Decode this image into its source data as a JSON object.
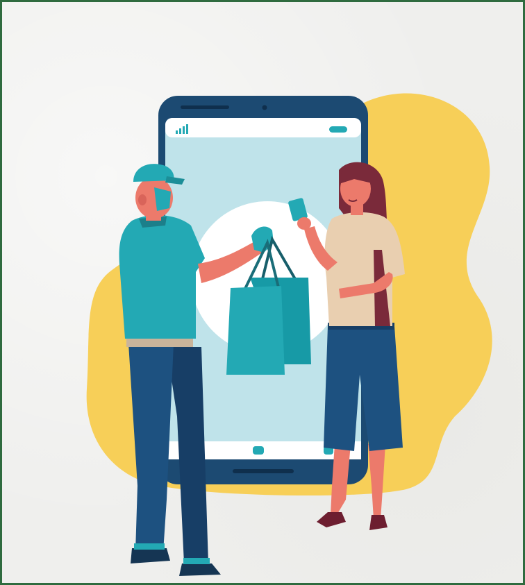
{
  "illustration": {
    "frame_color": "#2f6b3f",
    "background_color": "#efefed",
    "blob_color": "#f7cf58",
    "phone_body_color": "#1c4a72",
    "phone_screen_color": "#bfe3ea",
    "accent_color": "#23a9b4",
    "icons": [
      "signal-bars-icon",
      "battery-icon",
      "home-button-icon",
      "shopping-bag-icon",
      "credit-card-icon"
    ]
  }
}
